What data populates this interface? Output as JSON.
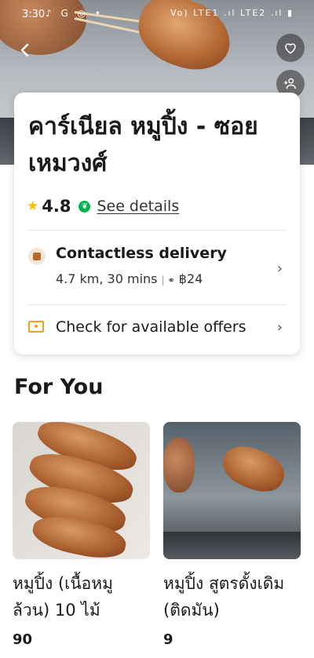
{
  "status_bar": {
    "time": "3:30",
    "app_icons": "♪ G ◎ •",
    "right": "Vo) LTE1 .ıl LTE2 .ıl ▮"
  },
  "colors": {
    "accent_green": "#00b14f",
    "star": "#f6c100",
    "offer": "#f0a020"
  },
  "restaurant": {
    "name": "คาร์เนียล หมูปิ้ง - ซอยเหมวงศ์",
    "rating": "4.8",
    "details_link": "See details"
  },
  "delivery": {
    "title": "Contactless delivery",
    "distance_time": "4.7 km, 30 mins",
    "fee": "฿24"
  },
  "offers": {
    "label": "Check for available offers"
  },
  "section": {
    "title": "For You"
  },
  "items": [
    {
      "name": "หมูปิ้ง (เนื้อหมูล้วน) 10 ไม้",
      "price": "90"
    },
    {
      "name": "หมูปิ้ง สูตรดั้งเดิม (ติดมัน)",
      "price": "9"
    }
  ],
  "icons": {
    "back": "back-arrow-icon",
    "favorite": "heart-icon",
    "group_order": "add-people-icon",
    "chevron": "chevron-right-icon"
  }
}
